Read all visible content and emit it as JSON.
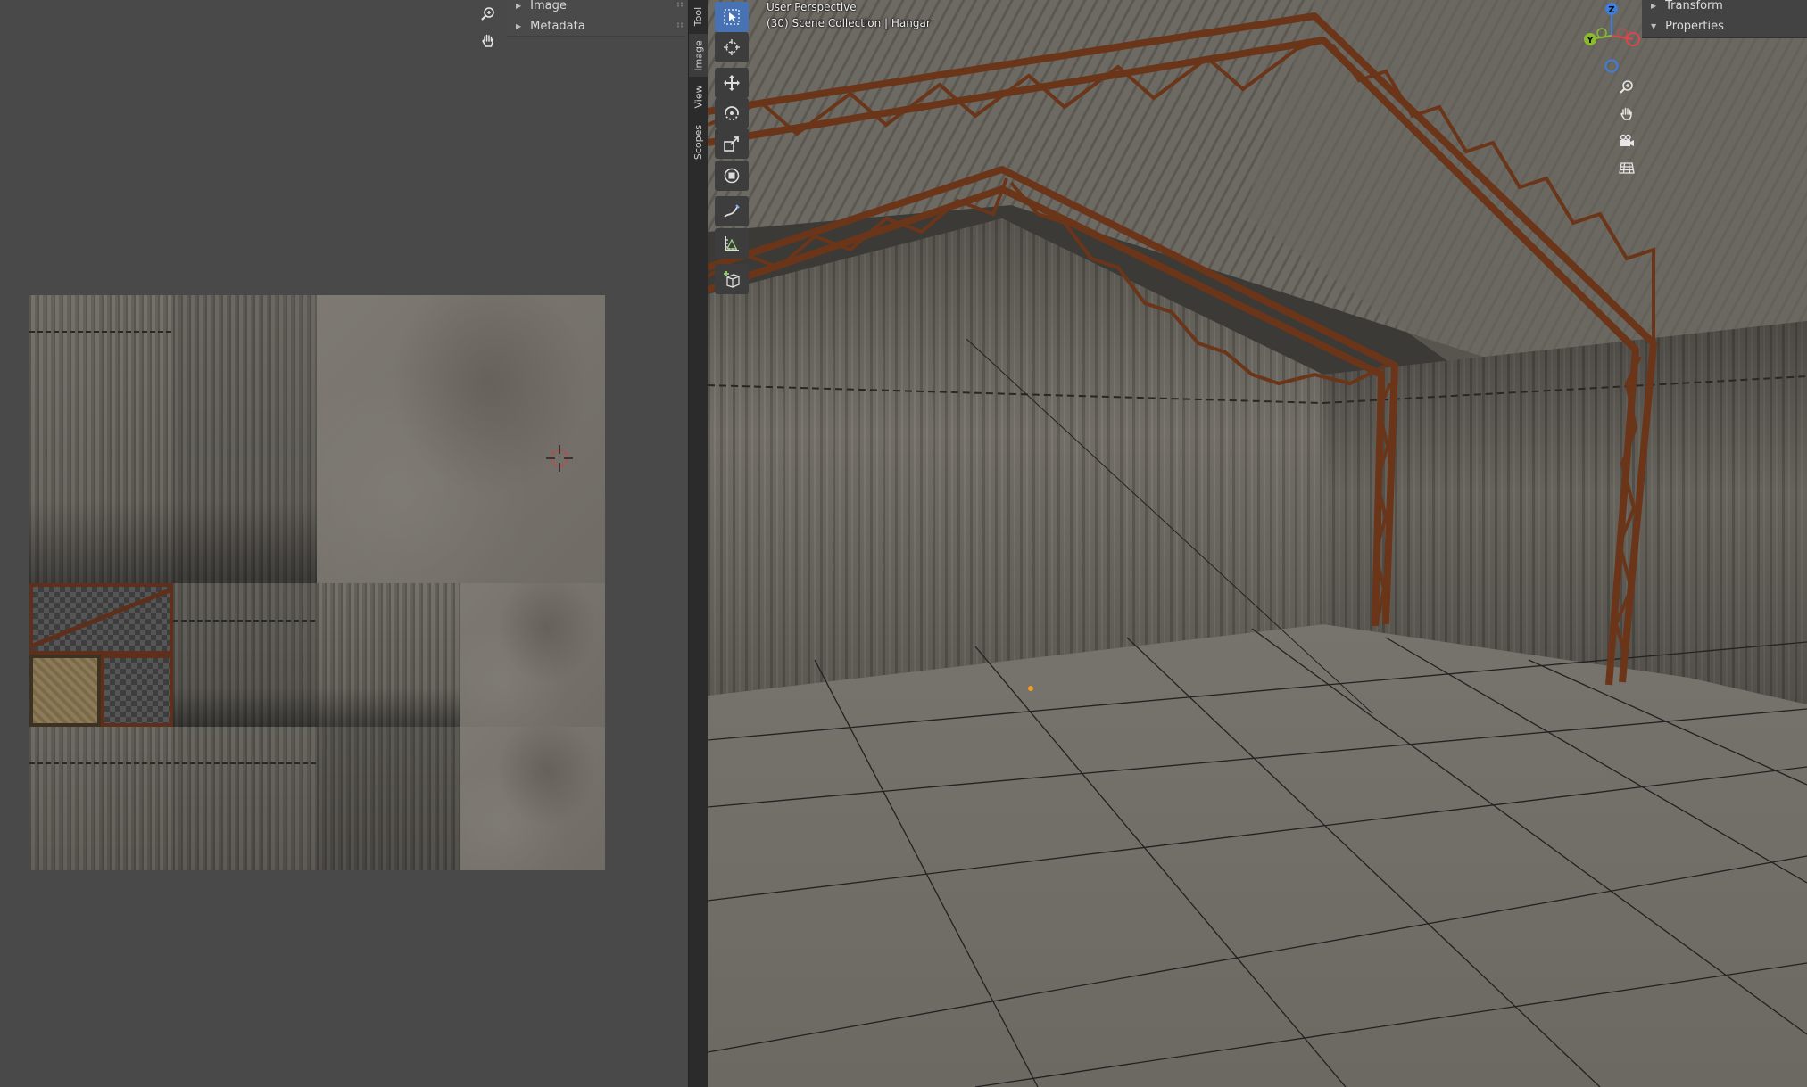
{
  "image_editor": {
    "sidebar_panels": [
      {
        "label": "Image",
        "expanded": false
      },
      {
        "label": "Metadata",
        "expanded": false
      }
    ],
    "nav_icons": [
      "zoom-icon",
      "pan-hand-icon"
    ]
  },
  "sidebar_tabs": [
    {
      "label": "Tool",
      "active": false
    },
    {
      "label": "Image",
      "active": true
    },
    {
      "label": "View",
      "active": false
    },
    {
      "label": "Scopes",
      "active": false
    }
  ],
  "viewport": {
    "perspective_label": "User Perspective",
    "collection_label": "(30) Scene Collection | Hangar",
    "tools": [
      "select-box-icon",
      "cursor-icon",
      "move-icon",
      "rotate-icon",
      "scale-icon",
      "transform-icon",
      "annotate-icon",
      "measure-icon",
      "add-cube-icon"
    ],
    "gizmo_axes": [
      "Z",
      "Y",
      "X"
    ],
    "nav_icons": [
      "zoom-icon",
      "pan-hand-icon",
      "camera-icon",
      "grid-view-icon"
    ],
    "sidebar_panels": [
      {
        "label": "Transform",
        "expanded": false
      },
      {
        "label": "Properties",
        "expanded": true
      }
    ]
  },
  "colors": {
    "active_tool": "#4772b3",
    "axis_x": "#e0444a",
    "axis_y": "#8bbb2b",
    "axis_z": "#3b7fe0",
    "rust": "#5e2f1a"
  }
}
